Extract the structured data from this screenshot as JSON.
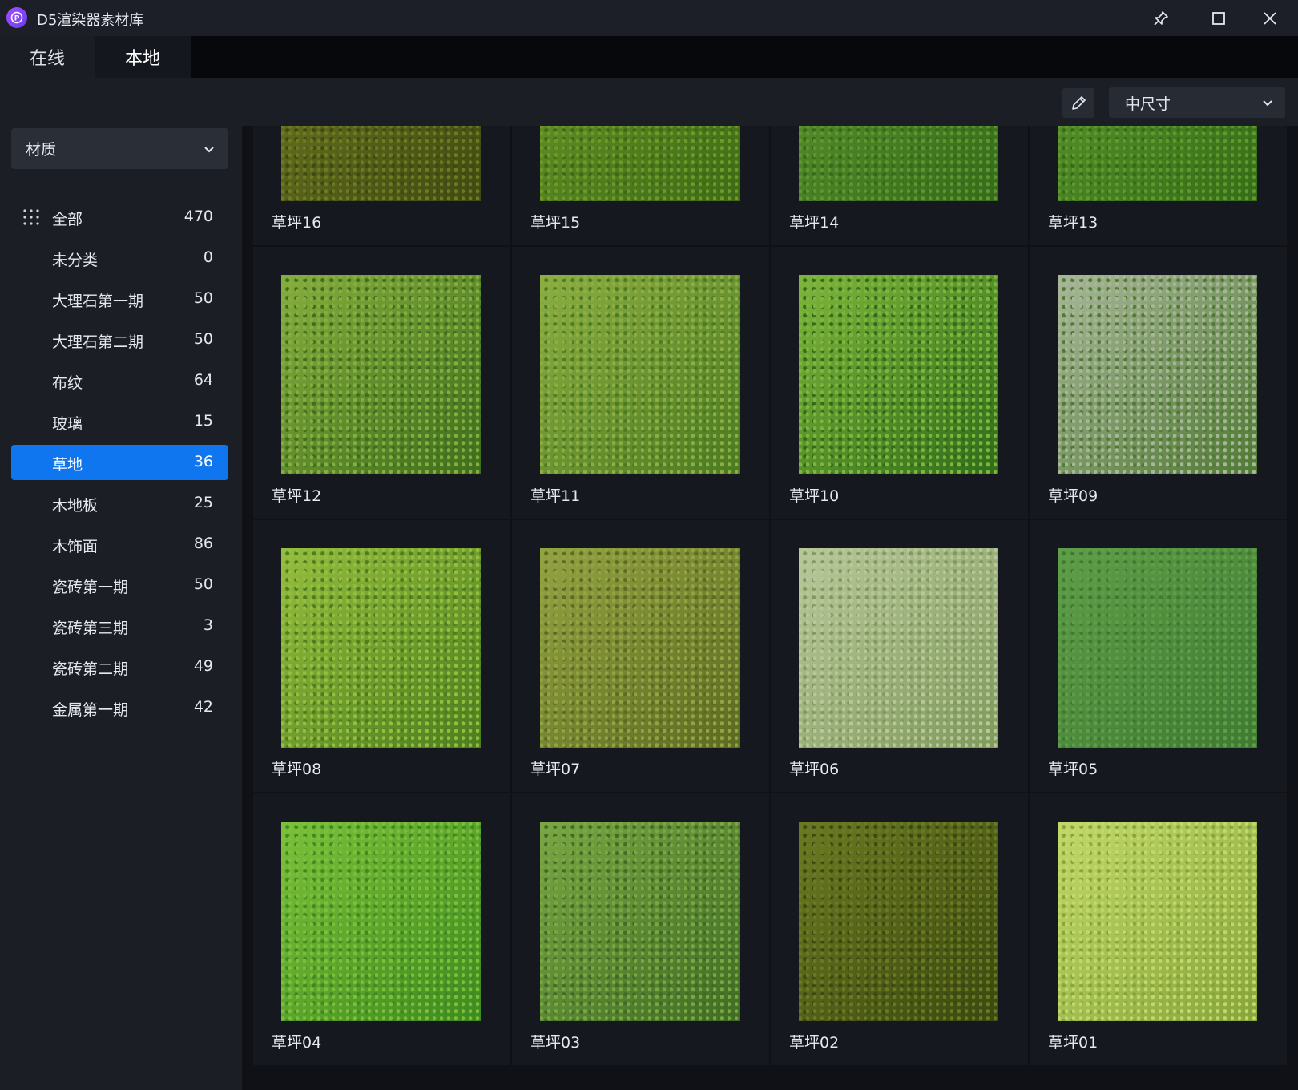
{
  "window": {
    "title": "D5渲染器素材库",
    "logo_letter": "P"
  },
  "tabs": [
    {
      "label": "在线",
      "active": false
    },
    {
      "label": "本地",
      "active": true
    }
  ],
  "toolbar": {
    "size_select_value": "中尺寸"
  },
  "sidebar": {
    "category_select": "材质",
    "items": [
      {
        "label": "全部",
        "count": "470"
      },
      {
        "label": "未分类",
        "count": "0"
      },
      {
        "label": "大理石第一期",
        "count": "50"
      },
      {
        "label": "大理石第二期",
        "count": "50"
      },
      {
        "label": "布纹",
        "count": "64"
      },
      {
        "label": "玻璃",
        "count": "15"
      },
      {
        "label": "草地",
        "count": "36",
        "selected": true
      },
      {
        "label": "木地板",
        "count": "25"
      },
      {
        "label": "木饰面",
        "count": "86"
      },
      {
        "label": "瓷砖第一期",
        "count": "50"
      },
      {
        "label": "瓷砖第三期",
        "count": "3"
      },
      {
        "label": "瓷砖第二期",
        "count": "49"
      },
      {
        "label": "金属第一期",
        "count": "42"
      }
    ]
  },
  "materials": [
    {
      "name": "草坪16",
      "color_a": "#6f7a22",
      "color_b": "#3f4a12"
    },
    {
      "name": "草坪15",
      "color_a": "#6d9a2a",
      "color_b": "#3e6a16"
    },
    {
      "name": "草坪14",
      "color_a": "#5f9630",
      "color_b": "#356a1a"
    },
    {
      "name": "草坪13",
      "color_a": "#5e9a2e",
      "color_b": "#366c18"
    },
    {
      "name": "草坪12",
      "color_a": "#86ad3e",
      "color_b": "#3d6e1d"
    },
    {
      "name": "草坪11",
      "color_a": "#8cae42",
      "color_b": "#4b7a22"
    },
    {
      "name": "草坪10",
      "color_a": "#7fb53c",
      "color_b": "#2f6c1a"
    },
    {
      "name": "草坪09",
      "color_a": "#a8b698",
      "color_b": "#4f7a34"
    },
    {
      "name": "草坪08",
      "color_a": "#95bd3e",
      "color_b": "#4c7e1f"
    },
    {
      "name": "草坪07",
      "color_a": "#93a342",
      "color_b": "#5c6a22"
    },
    {
      "name": "草坪06",
      "color_a": "#b8c79a",
      "color_b": "#7f9a5c"
    },
    {
      "name": "草坪05",
      "color_a": "#5f9e48",
      "color_b": "#3f7a32"
    },
    {
      "name": "草坪04",
      "color_a": "#7cc03a",
      "color_b": "#3e8a20"
    },
    {
      "name": "草坪03",
      "color_a": "#7aa644",
      "color_b": "#3f6c24"
    },
    {
      "name": "草坪02",
      "color_a": "#6a7a22",
      "color_b": "#3b4810"
    },
    {
      "name": "草坪01",
      "color_a": "#c2d868",
      "color_b": "#86a53c"
    }
  ],
  "colors": {
    "accent": "#1076f0",
    "background": "#14171e"
  }
}
